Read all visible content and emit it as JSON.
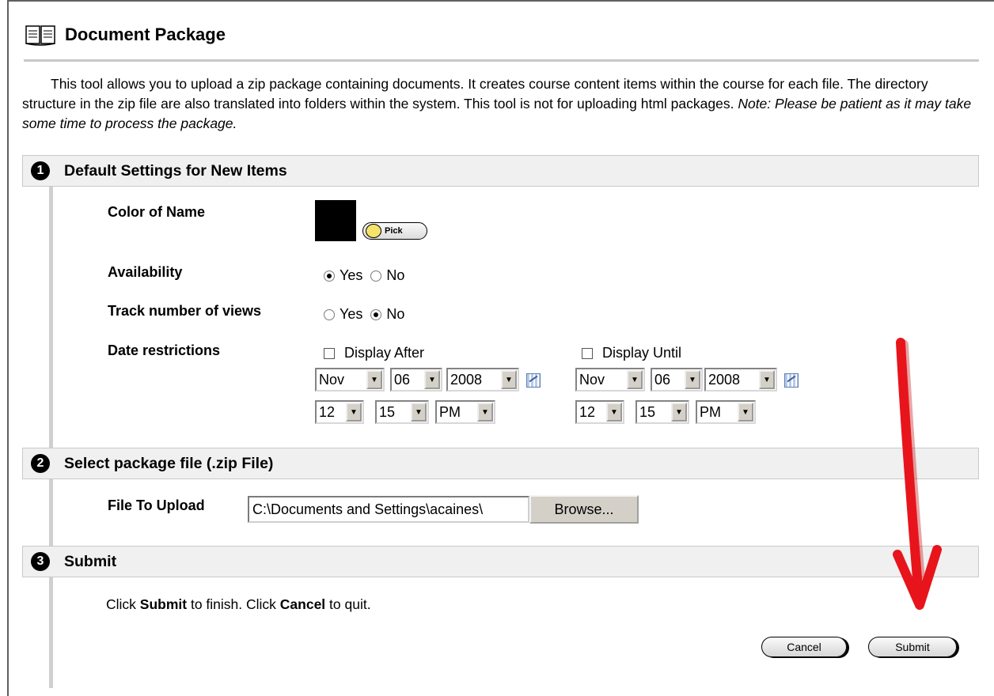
{
  "page": {
    "title": "Document Package",
    "intro_text": "This tool allows you to upload a zip package containing documents. It creates course content items within the course for each file. The directory structure in the zip file are also translated into folders within the system. This tool is not for uploading html packages.",
    "intro_note": "Note: Please be patient as it may take some time to process the package."
  },
  "sections": [
    {
      "number": "1",
      "label": "Default Settings for New Items"
    },
    {
      "number": "2",
      "label": "Select package file (.zip File)"
    },
    {
      "number": "3",
      "label": "Submit"
    }
  ],
  "defaults": {
    "color_label": "Color of Name",
    "color_value": "#000000",
    "pick_label": "Pick",
    "availability_label": "Availability",
    "availability_yes": "Yes",
    "availability_no": "No",
    "availability_selected": "Yes",
    "track_label": "Track number of views",
    "track_yes": "Yes",
    "track_no": "No",
    "track_selected": "No",
    "date_label": "Date restrictions",
    "display_after": {
      "label": "Display After",
      "checked": false,
      "month": "Nov",
      "day": "06",
      "year": "2008",
      "hour": "12",
      "minute": "15",
      "ampm": "PM"
    },
    "display_until": {
      "label": "Display Until",
      "checked": false,
      "month": "Nov",
      "day": "06",
      "year": "2008",
      "hour": "12",
      "minute": "15",
      "ampm": "PM"
    }
  },
  "upload": {
    "label": "File To Upload",
    "value": "C:\\Documents and Settings\\acaines\\",
    "browse_label": "Browse..."
  },
  "submit_section": {
    "pre": "Click ",
    "submit_word": "Submit",
    "mid": " to finish. Click ",
    "cancel_word": "Cancel",
    "post": " to quit.",
    "cancel_button": "Cancel",
    "submit_button": "Submit"
  },
  "colors": {
    "annotation_arrow": "#e8141b",
    "section_bar": "#f0f0f0"
  },
  "icons": {
    "title": "book-icon",
    "calendar": "calendar-icon",
    "pick": "palette-icon"
  }
}
